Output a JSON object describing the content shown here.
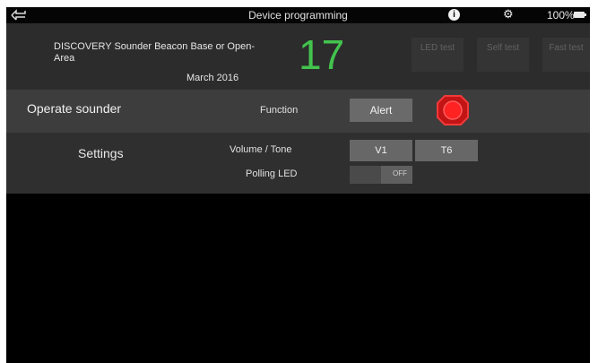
{
  "header": {
    "title": "Device programming",
    "info_icon_glyph": "i",
    "battery": "100%"
  },
  "device": {
    "name": "DISCOVERY Sounder Beacon Base or Open-Area",
    "date": "March 2016",
    "address": "17",
    "address_color": "#43c34e",
    "buttons": {
      "led_test": "LED test",
      "self_test": "Self test",
      "fast_test": "Fast test"
    }
  },
  "operate": {
    "label": "Operate sounder",
    "function_label": "Function",
    "function_value": "Alert",
    "indicator_color": "#e51c1c"
  },
  "settings": {
    "label": "Settings",
    "volume_label": "Volume / Tone",
    "volume_value": "V1",
    "tone_value": "T6",
    "polling_label": "Polling LED",
    "polling_value": "OFF"
  }
}
